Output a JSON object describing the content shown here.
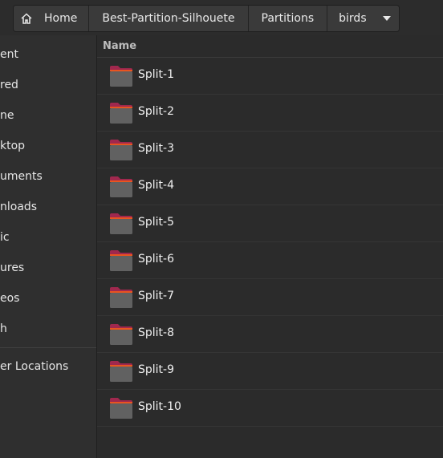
{
  "pathbar": {
    "home_label": "Home",
    "segments": [
      "Best-Partition-Silhouete",
      "Partitions",
      "birds"
    ]
  },
  "sidebar": {
    "items": [
      "ent",
      "red",
      "ne",
      "ktop",
      "uments",
      "nloads",
      "ic",
      "ures",
      "eos",
      "h"
    ],
    "other_locations": "er Locations"
  },
  "list": {
    "column_name": "Name",
    "items": [
      "Split-1",
      "Split-2",
      "Split-3",
      "Split-4",
      "Split-5",
      "Split-6",
      "Split-7",
      "Split-8",
      "Split-9",
      "Split-10"
    ]
  },
  "colors": {
    "folder_body": "#616161",
    "folder_tab": "#a0284e",
    "folder_accent": "#e95420"
  }
}
